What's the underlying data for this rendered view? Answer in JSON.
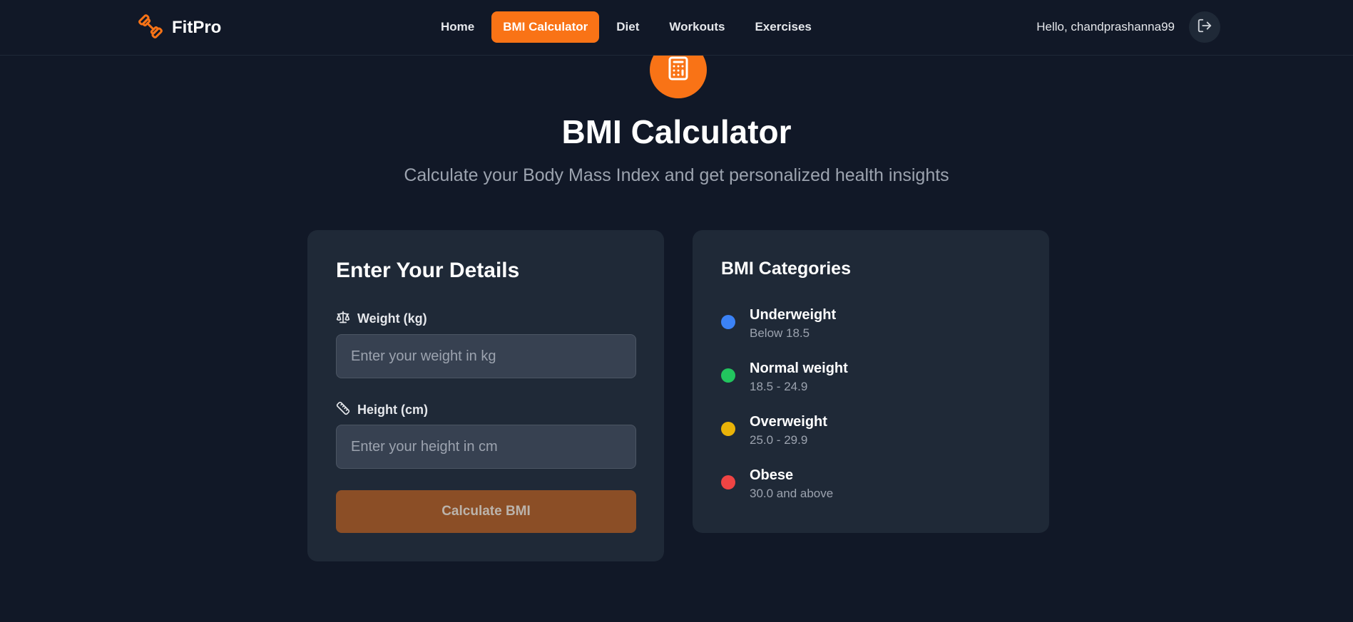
{
  "brand": {
    "name": "FitPro",
    "icon": "dumbbell-icon",
    "accent": "#f97316"
  },
  "nav": {
    "items": [
      {
        "label": "Home",
        "active": false
      },
      {
        "label": "BMI Calculator",
        "active": true
      },
      {
        "label": "Diet",
        "active": false
      },
      {
        "label": "Workouts",
        "active": false
      },
      {
        "label": "Exercises",
        "active": false
      }
    ]
  },
  "user": {
    "greeting": "Hello, chandprashanna99",
    "logout_icon": "logout-icon"
  },
  "hero": {
    "icon": "calculator-icon",
    "title": "BMI Calculator",
    "subtitle": "Calculate your Body Mass Index and get personalized health insights"
  },
  "form": {
    "title": "Enter Your Details",
    "weight": {
      "label": "Weight (kg)",
      "icon": "scale-icon",
      "value": "",
      "placeholder": "Enter your weight in kg"
    },
    "height": {
      "label": "Height (cm)",
      "icon": "ruler-icon",
      "value": "",
      "placeholder": "Enter your height in cm"
    },
    "submit_label": "Calculate BMI"
  },
  "categories": {
    "title": "BMI Categories",
    "items": [
      {
        "name": "Underweight",
        "range": "Below 18.5",
        "color": "#3b82f6"
      },
      {
        "name": "Normal weight",
        "range": "18.5 - 24.9",
        "color": "#22c55e"
      },
      {
        "name": "Overweight",
        "range": "25.0 - 29.9",
        "color": "#eab308"
      },
      {
        "name": "Obese",
        "range": "30.0 and above",
        "color": "#ef4444"
      }
    ]
  }
}
